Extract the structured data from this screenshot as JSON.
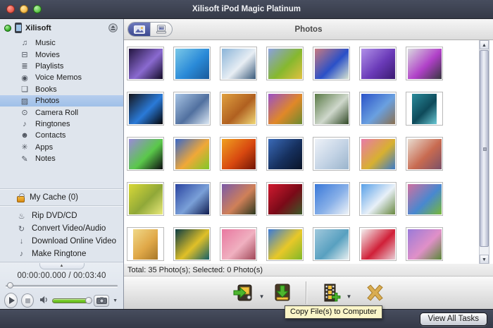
{
  "titlebar": {
    "title": "Xilisoft iPod Magic Platinum"
  },
  "sidebar": {
    "device": {
      "name": "Xilisoft"
    },
    "items": [
      {
        "label": "Music",
        "glyph": "♫",
        "icon_name": "music-note-icon"
      },
      {
        "label": "Movies",
        "glyph": "⊟",
        "icon_name": "film-icon"
      },
      {
        "label": "Playlists",
        "glyph": "≣",
        "icon_name": "playlist-icon"
      },
      {
        "label": "Voice Memos",
        "glyph": "◉",
        "icon_name": "microphone-icon"
      },
      {
        "label": "Books",
        "glyph": "❏",
        "icon_name": "book-icon"
      },
      {
        "label": "Photos",
        "glyph": "▨",
        "icon_name": "photo-icon",
        "selected": true
      },
      {
        "label": "Camera Roll",
        "glyph": "⊙",
        "icon_name": "camera-icon"
      },
      {
        "label": "Ringtones",
        "glyph": "♪",
        "icon_name": "ringtone-icon"
      },
      {
        "label": "Contacts",
        "glyph": "☻",
        "icon_name": "contact-icon"
      },
      {
        "label": "Apps",
        "glyph": "✳",
        "icon_name": "apps-icon"
      },
      {
        "label": "Notes",
        "glyph": "✎",
        "icon_name": "notes-icon"
      }
    ],
    "cache_label": "My Cache (0)",
    "tools": [
      {
        "label": "Rip DVD/CD",
        "glyph": "♨",
        "icon_name": "rip-disc-icon"
      },
      {
        "label": "Convert Video/Audio",
        "glyph": "↻",
        "icon_name": "convert-icon"
      },
      {
        "label": "Download Online Video",
        "glyph": "↓",
        "icon_name": "download-icon"
      },
      {
        "label": "Make Ringtone",
        "glyph": "♪",
        "icon_name": "bell-icon"
      }
    ],
    "player": {
      "time": "00:00:00.000 / 00:03:40"
    }
  },
  "content": {
    "header": "Photos",
    "status": "Total: 35 Photo(s); Selected: 0 Photo(s)",
    "photos": [
      {
        "name": "purple-christmas-tree",
        "g": [
          "#241640",
          "#8a6ad0",
          "#120a26"
        ]
      },
      {
        "name": "tropical-coast",
        "g": [
          "#7ac8e8",
          "#2a8ad8",
          "#1a5a9a"
        ]
      },
      {
        "name": "mountain-lake",
        "g": [
          "#8ab4d8",
          "#e8eef4",
          "#3a5a7a"
        ]
      },
      {
        "name": "blue-butterfly-flowers",
        "g": [
          "#8aa0e0",
          "#86b82e",
          "#e0c040"
        ]
      },
      {
        "name": "bluebird-blossoms",
        "g": [
          "#c87a80",
          "#2a50c8",
          "#d8e4d0"
        ]
      },
      {
        "name": "purple-butterfly",
        "g": [
          "#b090e8",
          "#6a3ab8",
          "#3a1a70"
        ]
      },
      {
        "name": "butterfly-on-metal",
        "g": [
          "#d8d8de",
          "#b040c8",
          "#36363e"
        ]
      },
      {
        "name": "black-cat-blue-eyes",
        "g": [
          "#16161c",
          "#2a7ad8",
          "#050508"
        ]
      },
      {
        "name": "moon-fairy",
        "g": [
          "#a8c4e4",
          "#51709f",
          "#dce8f4"
        ]
      },
      {
        "name": "autumn-valley",
        "g": [
          "#e0a040",
          "#b06020",
          "#f0d878"
        ]
      },
      {
        "name": "purple-orange-flowers",
        "g": [
          "#9a50c8",
          "#e08828",
          "#6a8a30"
        ]
      },
      {
        "name": "white-horse",
        "g": [
          "#5a7a46",
          "#cfd8cc",
          "#324a28"
        ]
      },
      {
        "name": "beach-dusk",
        "g": [
          "#2a52c8",
          "#6aa0e0",
          "#8a7050"
        ]
      },
      {
        "name": "mermaid",
        "g": [
          "#2a8a9a",
          "#0e4a5a",
          "#6ac8d4"
        ],
        "portrait": true
      },
      {
        "name": "rainbow-rose",
        "g": [
          "#9a8ad8",
          "#5ac84a",
          "#0c0c10"
        ]
      },
      {
        "name": "sunrise-meadow",
        "g": [
          "#3a68c8",
          "#f0a838",
          "#80c828"
        ]
      },
      {
        "name": "red-sunset-lake",
        "g": [
          "#f0a020",
          "#d84810",
          "#701505"
        ]
      },
      {
        "name": "planet-night-sky",
        "g": [
          "#3a6ab8",
          "#16305e",
          "#0a1428"
        ]
      },
      {
        "name": "ice-angel",
        "g": [
          "#eef2f8",
          "#c2d2e4",
          "#9ab4cc"
        ]
      },
      {
        "name": "cherry-blossoms",
        "g": [
          "#e87aa8",
          "#d8b030",
          "#3a7ac8"
        ]
      },
      {
        "name": "seaside-villa-sunset",
        "g": [
          "#e8dcd0",
          "#c86a50",
          "#7a5068"
        ]
      },
      {
        "name": "autumn-park",
        "g": [
          "#d8d838",
          "#90a838",
          "#e8e87a"
        ]
      },
      {
        "name": "swan-night-water",
        "g": [
          "#2a44a0",
          "#7aa0d8",
          "#101c50"
        ]
      },
      {
        "name": "twilight-field",
        "g": [
          "#7a5aa8",
          "#d08058",
          "#2c381f"
        ]
      },
      {
        "name": "red-rose",
        "g": [
          "#d01a30",
          "#7a0a18",
          "#3a5a28"
        ]
      },
      {
        "name": "daisy-blue-sky",
        "g": [
          "#3a78d8",
          "#88b0e8",
          "#f0f4f8"
        ]
      },
      {
        "name": "country-house-clouds",
        "g": [
          "#58a0e8",
          "#e8f0f8",
          "#688840"
        ]
      },
      {
        "name": "mandarin-fish",
        "g": [
          "#d070a0",
          "#4888d0",
          "#78b838"
        ]
      },
      {
        "name": "golden-bride",
        "g": [
          "#f0d888",
          "#e0a848",
          "#a87828"
        ],
        "portrait": true
      },
      {
        "name": "yellow-butterfly",
        "g": [
          "#0c3c44",
          "#e0c028",
          "#156068"
        ]
      },
      {
        "name": "pink-spring-trees",
        "g": [
          "#e878a0",
          "#f0b0c0",
          "#a04858"
        ]
      },
      {
        "name": "sunflower-field",
        "g": [
          "#3a7ad8",
          "#e8c828",
          "#80b828"
        ]
      },
      {
        "name": "waterfall",
        "g": [
          "#a0c8dc",
          "#58a0c0",
          "#e8f0f0"
        ]
      },
      {
        "name": "red-roses-gift",
        "g": [
          "#f4f0f0",
          "#d02038",
          "#e8ccd4"
        ]
      },
      {
        "name": "lupine-meadow",
        "g": [
          "#9a7ad8",
          "#e090c8",
          "#5a8838"
        ]
      }
    ]
  },
  "actionbar": {
    "tooltip": "Copy File(s) to Computer"
  },
  "bottombar": {
    "view_all_tasks": "View All Tasks"
  },
  "colors": {
    "titlebar": "#3b4150",
    "selection": "#a9c6e9",
    "tooltip_bg": "#faf5c8",
    "volume_green": "#86d832",
    "accent_segment": "#4a56a0"
  }
}
